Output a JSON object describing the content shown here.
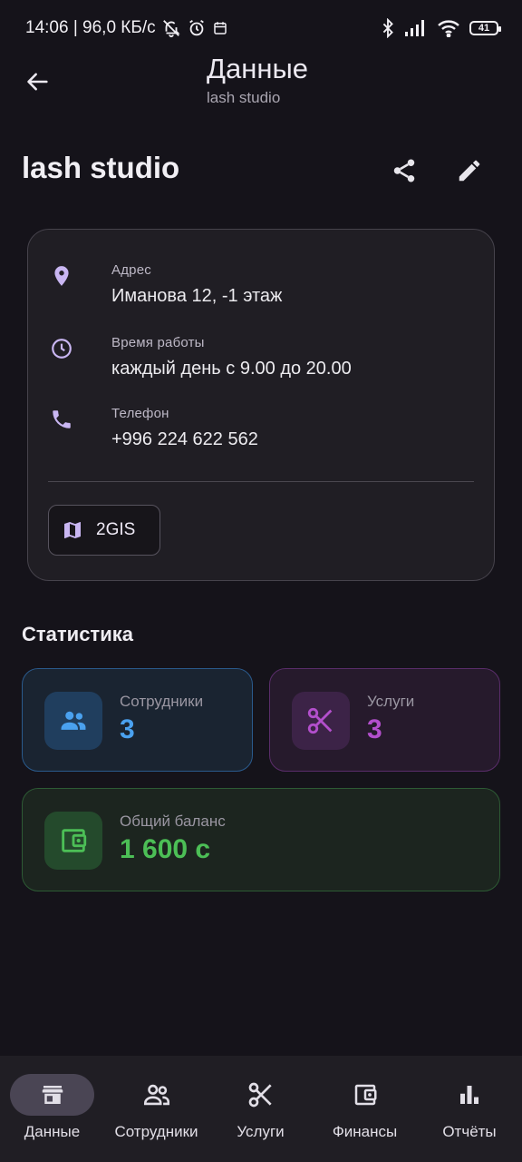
{
  "status_bar": {
    "time_speed": "14:06 | 96,0 КБ/с",
    "battery": "41"
  },
  "appbar": {
    "title": "Данные",
    "subtitle": "lash studio"
  },
  "studio": {
    "name": "lash studio"
  },
  "info": {
    "address_label": "Адрес",
    "address_value": "Иманова 12, -1 этаж",
    "hours_label": "Время работы",
    "hours_value": "каждый день с 9.00 до 20.00",
    "phone_label": "Телефон",
    "phone_value": "+996 224 622 562",
    "map_button": "2GIS"
  },
  "stats": {
    "title": "Статистика",
    "staff_label": "Сотрудники",
    "staff_value": "3",
    "services_label": "Услуги",
    "services_value": "3",
    "balance_label": "Общий баланс",
    "balance_value": "1 600 с"
  },
  "nav": {
    "items": [
      {
        "label": "Данные",
        "icon": "store-icon",
        "active": true
      },
      {
        "label": "Сотрудники",
        "icon": "people-icon",
        "active": false
      },
      {
        "label": "Услуги",
        "icon": "scissors-icon",
        "active": false
      },
      {
        "label": "Финансы",
        "icon": "wallet-icon",
        "active": false
      },
      {
        "label": "Отчёты",
        "icon": "bar-chart-icon",
        "active": false
      }
    ]
  },
  "colors": {
    "accent": "#c9b6f2",
    "staff": "#4aa1ef",
    "services": "#b34fcc",
    "balance": "#4cbf56"
  }
}
